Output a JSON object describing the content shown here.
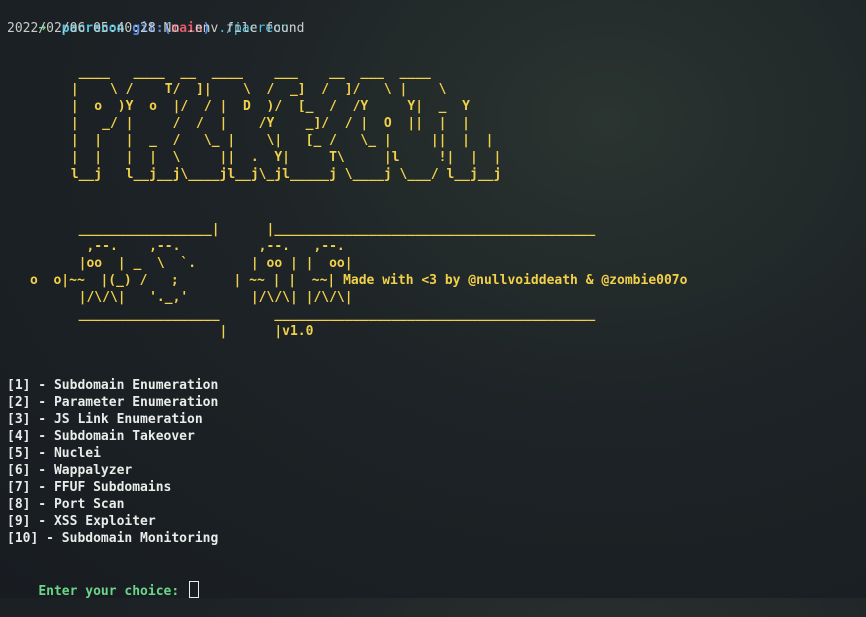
{
  "prompt": {
    "arrow": "➜",
    "dir": "pacrecon",
    "git_label": "git:(",
    "branch": "main",
    "git_close": ")",
    "command": "./pacrecon"
  },
  "log_line": "2022/02/06 05:40:28 No .env file found",
  "banner": {
    "logo_lines": [
      "  ____   ____  __  ____    ___    __  ___  ____",
      " |    \\ /    T/  ]|    \\  /  _]  /  ]/   \\ |    \\",
      " |  o  )Y  o  |/  / |  D  )/  [_  /  /Y     Y|  _  Y",
      " |   _/ |     /  /  |    /Y    _]/  / |  O  ||  |  |",
      " |  |   |  _  /   \\_ |    \\|   [_ /   \\_ |     ||  |  |",
      " |  |   |  |  \\     ||  .  Y|     T\\     |l     !|  |  |",
      " l__j   l__j__j\\____jl__j\\_jl_____j \\____j \\___/ l__j__j"
    ],
    "pac_lines": [
      "  _________________|      |_________________________________________",
      "   ,--.    ,--.          ,--.   ,--.",
      "  |oo  | _  \\  `.       | oo | |  oo|",
      "o  o|~~  |(_) /   ;       | ~~ | |  ~~|",
      "  |/\\/\\|   '._,'        |/\\/\\| |/\\/\\|",
      "  __________________       _________________________________________",
      "                    |      |"
    ],
    "tagline": "Made with <3 by @nullvoiddeath & @zombie007o",
    "version": "v1.0"
  },
  "menu": {
    "items": [
      "[1] - Subdomain Enumeration",
      "[2] - Parameter Enumeration",
      "[3] - JS Link Enumeration",
      "[4] - Subdomain Takeover",
      "[5] - Nuclei",
      "[6] - Wappalyzer",
      "[7] - FFUF Subdomains",
      "[8] - Port Scan",
      "[9] - XSS Exploiter",
      "[10] - Subdomain Monitoring"
    ]
  },
  "input": {
    "label": "Enter your choice: "
  },
  "colors": {
    "background": "#1d2326",
    "banner": "#f2d14a",
    "prompt_green": "#6bd68a",
    "prompt_cyan": "#4fc6e6",
    "branch_red": "#e15a6a"
  }
}
